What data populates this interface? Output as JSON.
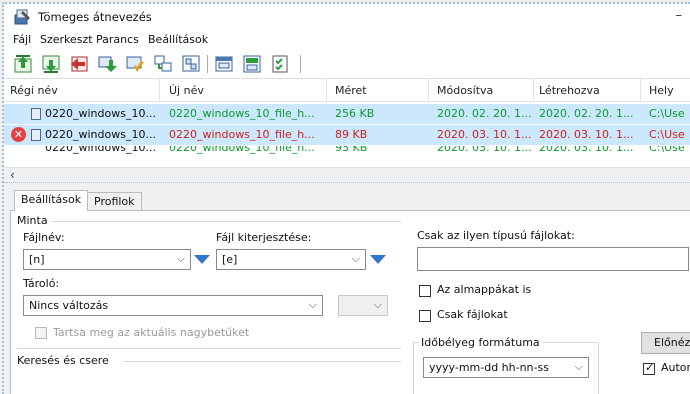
{
  "window": {
    "title": "Tömeges átnevezés",
    "minimize_glyph": "–"
  },
  "menu": [
    "Fájl",
    "Szerkeszt",
    "Parancs",
    "Beállítások"
  ],
  "toolbar_icons": [
    "move-top-icon",
    "move-bottom-icon",
    "move-up-icon",
    "move-down-icon",
    "remove-icon",
    "add-files-icon",
    "add-folder-icon",
    "open-icon",
    "save-icon",
    "checklist-icon"
  ],
  "file_list": {
    "headers": [
      "Régi név",
      "Új név",
      "Méret",
      "Módosítva",
      "Létrehozva",
      "Hely"
    ],
    "rows": [
      {
        "old": "0220_windows_10...",
        "new": "0220_windows_10_file_h...",
        "size": "256 KB",
        "modified": "2020. 02. 20. 1...",
        "created": "2020. 02. 20. 1...",
        "location": "C:\\Use",
        "status": "ok"
      },
      {
        "old": "0220_windows_10...",
        "new": "0220_windows_10_file_h...",
        "size": "89 KB",
        "modified": "2020. 03. 10. 1...",
        "created": "2020. 03. 10. 1...",
        "location": "C:\\Use",
        "status": "error"
      },
      {
        "old": "0220_windows_10...",
        "new": "0220_windows_10_file_h...",
        "size": "93 KB",
        "modified": "2020. 03. 10. 1...",
        "created": "2020. 03. 10. 1...",
        "location": "C:\\Use",
        "status": "ok"
      }
    ],
    "error_glyph": "✕",
    "scroll_left_glyph": "‹"
  },
  "tabs": {
    "active": "Beállítások",
    "inactive": "Profilok"
  },
  "settings": {
    "pattern_group": "Minta",
    "filename_label": "Fájlnév:",
    "filename_value": "[n]",
    "extension_label": "Fájl kiterjesztése:",
    "extension_value": "[e]",
    "storage_label": "Tároló:",
    "storage_value": "Nincs változás",
    "keep_case_label": "Tartsa meg az aktuális nagybetűket",
    "search_replace_group": "Keresés és csere",
    "file_types_label": "Csak az ilyen típusú fájlokat:",
    "file_types_value": "",
    "subfolders_label": "Az almappákat is",
    "files_only_label": "Csak fájlokat",
    "timestamp_group": "Időbélyeg formátuma",
    "timestamp_value": "yyyy-mm-dd hh-nn-ss",
    "preview_button": "Előnézet",
    "auto_label": "Automatikus",
    "auto_checked": true,
    "combo_arrow": "⌵"
  }
}
